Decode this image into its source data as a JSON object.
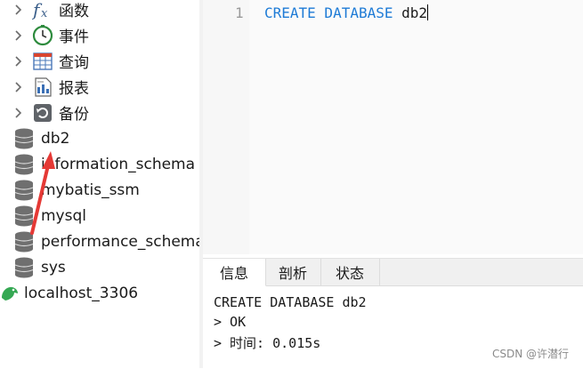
{
  "nav": {
    "objects": [
      {
        "label": "函数",
        "icon": "function-icon"
      },
      {
        "label": "事件",
        "icon": "clock-icon"
      },
      {
        "label": "查询",
        "icon": "query-grid-icon"
      },
      {
        "label": "报表",
        "icon": "report-icon"
      },
      {
        "label": "备份",
        "icon": "backup-icon"
      }
    ],
    "databases": [
      "db2",
      "information_schema",
      "mybatis_ssm",
      "mysql",
      "performance_schema",
      "sys"
    ],
    "connection": "localhost_3306"
  },
  "editor": {
    "line_number": "1",
    "sql_keywords": "CREATE DATABASE",
    "sql_identifier": "db2"
  },
  "result": {
    "tabs": [
      "信息",
      "剖析",
      "状态"
    ],
    "active_tab": "信息",
    "lines": [
      "CREATE DATABASE db2",
      "> OK",
      "> 时间: 0.015s"
    ]
  },
  "watermark": "CSDN @许潜行",
  "colors": {
    "keyword": "#1e7bd6",
    "arrow": "#e53935"
  }
}
